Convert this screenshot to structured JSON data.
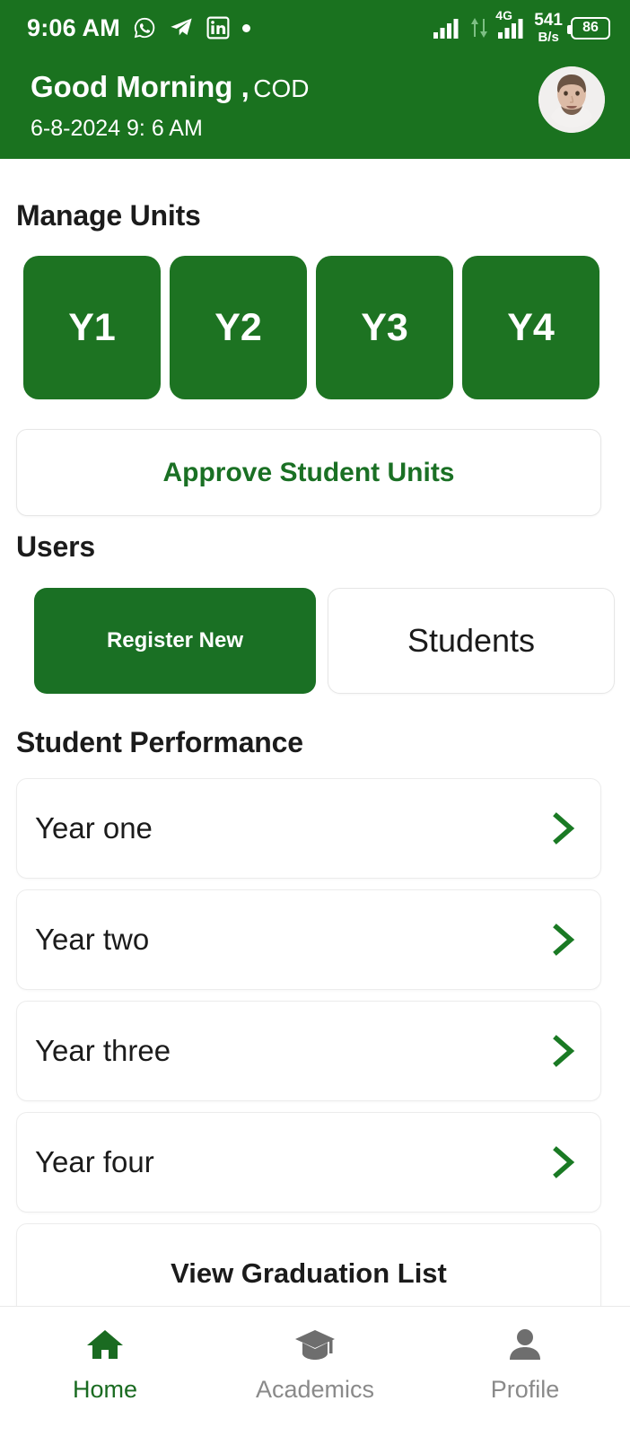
{
  "statusbar": {
    "time": "9:06 AM",
    "icons": [
      "whatsapp-icon",
      "telegram-icon",
      "linkedin-icon",
      "dot-icon"
    ],
    "network_type": "4G",
    "data_speed_value": "541",
    "data_speed_unit": "B/s",
    "battery_percent": "86"
  },
  "header": {
    "greeting": "Good Morning",
    "comma": " ,",
    "user": "COD",
    "datetime": "6-8-2024  9: 6 AM",
    "avatar_name": "user-avatar",
    "background_color": "#1a721f"
  },
  "manage_units": {
    "title": "Manage Units",
    "buttons": [
      {
        "label": "Y1"
      },
      {
        "label": "Y2"
      },
      {
        "label": "Y3"
      },
      {
        "label": "Y4"
      }
    ],
    "approve_label": "Approve Student Units",
    "accent_color": "#1d7322"
  },
  "users": {
    "title": "Users",
    "register_label": "Register New",
    "students_label": "Students"
  },
  "performance": {
    "title": "Student Performance",
    "rows": [
      {
        "label": "Year one",
        "chevron": "chevron-right-icon"
      },
      {
        "label": "Year two",
        "chevron": "chevron-right-icon"
      },
      {
        "label": "Year three",
        "chevron": "chevron-right-icon"
      },
      {
        "label": "Year four",
        "chevron": "chevron-right-icon"
      }
    ],
    "graduation_label": "View Graduation List"
  },
  "bottom_nav": {
    "items": [
      {
        "label": "Home",
        "icon": "home-icon",
        "active": true
      },
      {
        "label": "Academics",
        "icon": "graduation-cap-icon",
        "active": false
      },
      {
        "label": "Profile",
        "icon": "person-icon",
        "active": false
      }
    ],
    "active_color": "#1a6b21",
    "inactive_color": "#8a8a8a"
  }
}
